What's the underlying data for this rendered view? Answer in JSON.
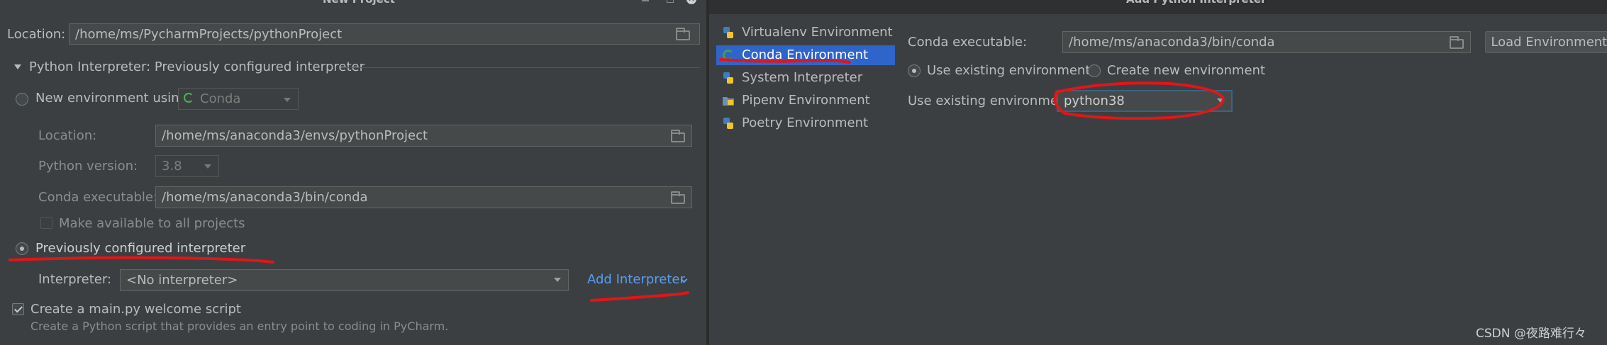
{
  "left_dialog": {
    "title": "New Project",
    "location_label": "Location:",
    "location_value": "/home/ms/PycharmProjects/pythonProject",
    "interpreter_section": "Python Interpreter: Previously configured interpreter",
    "new_env_label": "New environment using",
    "new_env_tool": "Conda",
    "env_location_label": "Location:",
    "env_location_value": "/home/ms/anaconda3/envs/pythonProject",
    "python_version_label": "Python version:",
    "python_version_value": "3.8",
    "conda_exec_label": "Conda executable:",
    "conda_exec_value": "/home/ms/anaconda3/bin/conda",
    "make_available_label": "Make available to all projects",
    "previously_configured_label": "Previously configured interpreter",
    "interpreter_label": "Interpreter:",
    "interpreter_value": "<No interpreter>",
    "add_interpreter_label": "Add Interpreter",
    "create_main_label": "Create a main.py welcome script",
    "create_main_desc": "Create a Python script that provides an entry point to coding in PyCharm."
  },
  "right_dialog": {
    "title": "Add Python Interpreter",
    "env_list": [
      {
        "label": "Virtualenv Environment",
        "icon": "python-icon"
      },
      {
        "label": "Conda Environment",
        "icon": "conda-icon"
      },
      {
        "label": "System Interpreter",
        "icon": "python-icon"
      },
      {
        "label": "Pipenv Environment",
        "icon": "pipenv-icon"
      },
      {
        "label": "Poetry Environment",
        "icon": "python-icon"
      }
    ],
    "selected_env_index": 1,
    "conda_exec_label": "Conda executable:",
    "conda_exec_value": "/home/ms/anaconda3/bin/conda",
    "load_envs_button": "Load Environments",
    "use_existing_radio": "Use existing environment",
    "create_new_radio": "Create new environment",
    "use_existing_label": "Use existing environment:",
    "use_existing_value": "python38"
  },
  "watermark": "CSDN @夜路难行々",
  "colors": {
    "background": "#3c3f41",
    "selection": "#2f65ca",
    "link": "#589df6",
    "annotation": "#e0161a"
  }
}
